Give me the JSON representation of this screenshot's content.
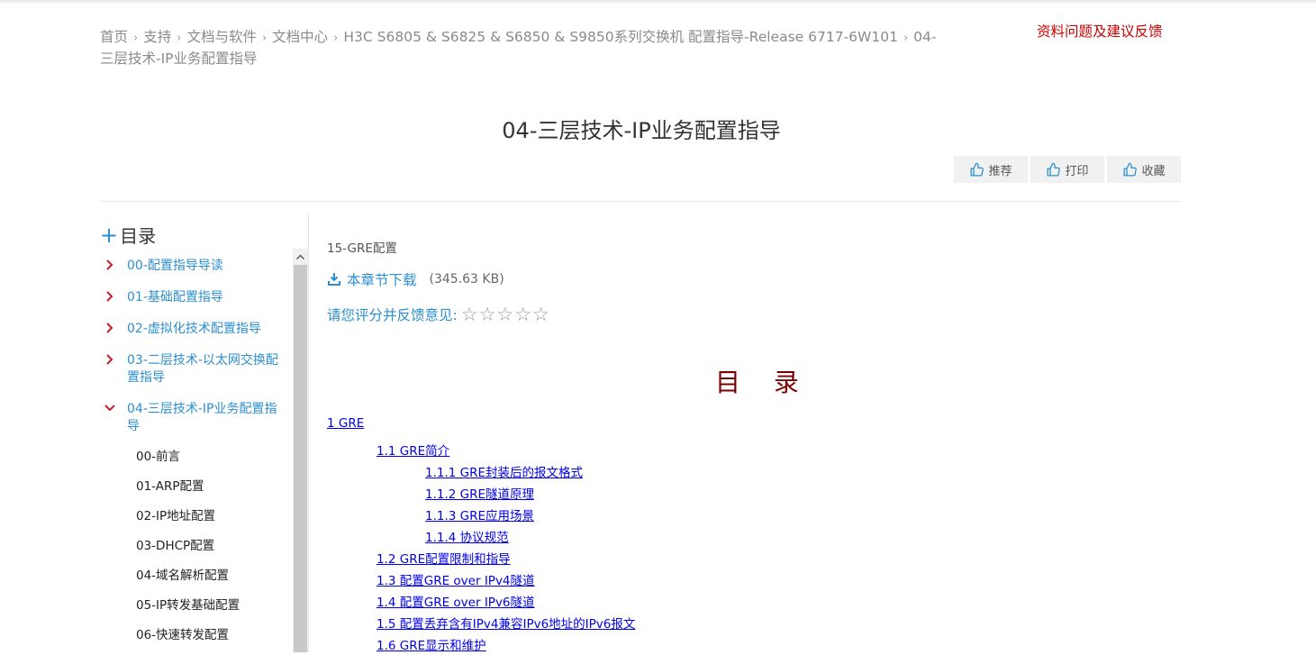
{
  "breadcrumb": {
    "items": [
      "首页",
      "支持",
      "文档与软件",
      "文档中心",
      "H3C S6805 & S6825 & S6850 & S9850系列交换机 配置指导-Release 6717-6W101",
      "04-三层技术-IP业务配置指导"
    ],
    "separator": "›"
  },
  "feedback_link": "资料问题及建议反馈",
  "page_title": "04-三层技术-IP业务配置指导",
  "actions": [
    {
      "label": "推荐",
      "icon": "thumbs-up-icon"
    },
    {
      "label": "打印",
      "icon": "thumbs-up-icon"
    },
    {
      "label": "收藏",
      "icon": "thumbs-up-icon"
    }
  ],
  "sidebar": {
    "heading_icon": "+",
    "heading": "目录",
    "items": [
      {
        "label": "00-配置指导导读",
        "expanded": false
      },
      {
        "label": "01-基础配置指导",
        "expanded": false
      },
      {
        "label": "02-虚拟化技术配置指导",
        "expanded": false
      },
      {
        "label": "03-二层技术-以太网交换配置指导",
        "expanded": false
      },
      {
        "label": "04-三层技术-IP业务配置指导",
        "expanded": true
      }
    ],
    "subitems": [
      "00-前言",
      "01-ARP配置",
      "02-IP地址配置",
      "03-DHCP配置",
      "04-域名解析配置",
      "05-IP转发基础配置",
      "06-快速转发配置"
    ]
  },
  "content": {
    "chapter": "15-GRE配置",
    "download_label": "本章节下载",
    "download_size": "(345.63 KB)",
    "rating_label": "请您评分并反馈意见:",
    "rating_stars": [
      "☆",
      "☆",
      "☆",
      "☆",
      "☆"
    ],
    "mulu_title": "目 录",
    "toc": [
      {
        "text": "1 GRE",
        "level": 1
      },
      {
        "text": "1.1 GRE简介",
        "level": 2
      },
      {
        "text": "1.1.1 GRE封装后的报文格式",
        "level": 3
      },
      {
        "text": "1.1.2 GRE隧道原理",
        "level": 3
      },
      {
        "text": "1.1.3 GRE应用场景",
        "level": 3
      },
      {
        "text": "1.1.4 协议规范",
        "level": 3
      },
      {
        "text": "1.2 GRE配置限制和指导",
        "level": 2
      },
      {
        "text": "1.3 配置GRE over IPv4隧道",
        "level": 2
      },
      {
        "text": "1.4 配置GRE over IPv6隧道",
        "level": 2
      },
      {
        "text": "1.5 配置丢弃含有IPv4兼容IPv6地址的IPv6报文",
        "level": 2
      },
      {
        "text": "1.6 GRE显示和维护",
        "level": 2
      }
    ]
  },
  "colors": {
    "accent": "#2b8fd0",
    "feedback": "#cc0000",
    "mulu": "#7a0000",
    "link": "#0000ee"
  }
}
